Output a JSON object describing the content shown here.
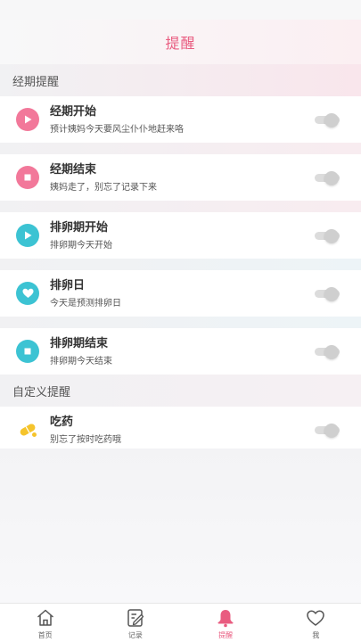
{
  "header": {
    "title": "提醒"
  },
  "sections": [
    {
      "title": "经期提醒",
      "items": [
        {
          "title": "经期开始",
          "subtitle": "预计姨妈今天要风尘仆仆地赶来咯",
          "icon": "play-icon",
          "enabled": false
        },
        {
          "title": "经期结束",
          "subtitle": "姨妈走了，别忘了记录下来",
          "icon": "stop-icon",
          "enabled": false
        },
        {
          "title": "排卵期开始",
          "subtitle": "排卵期今天开始",
          "icon": "play-icon",
          "enabled": false
        },
        {
          "title": "排卵日",
          "subtitle": "今天是预测排卵日",
          "icon": "heart-icon",
          "enabled": false
        },
        {
          "title": "排卵期结束",
          "subtitle": "排卵期今天结束",
          "icon": "stop-icon",
          "enabled": false
        }
      ]
    },
    {
      "title": "自定义提醒",
      "items": [
        {
          "title": "吃药",
          "subtitle": "别忘了按时吃药哦",
          "icon": "pill-icon",
          "enabled": false
        }
      ]
    }
  ],
  "tabbar": {
    "tabs": [
      {
        "label": "首页",
        "icon": "home-icon",
        "active": false
      },
      {
        "label": "记录",
        "icon": "note-edit-icon",
        "active": false
      },
      {
        "label": "提醒",
        "icon": "bell-icon",
        "active": true
      },
      {
        "label": "我",
        "icon": "heart-outline-icon",
        "active": false
      }
    ]
  },
  "colors": {
    "accent": "#e95c80",
    "pink_icon": "#f2789a",
    "cyan_icon": "#3cc3d3",
    "pill_yellow": "#f5c42c"
  }
}
